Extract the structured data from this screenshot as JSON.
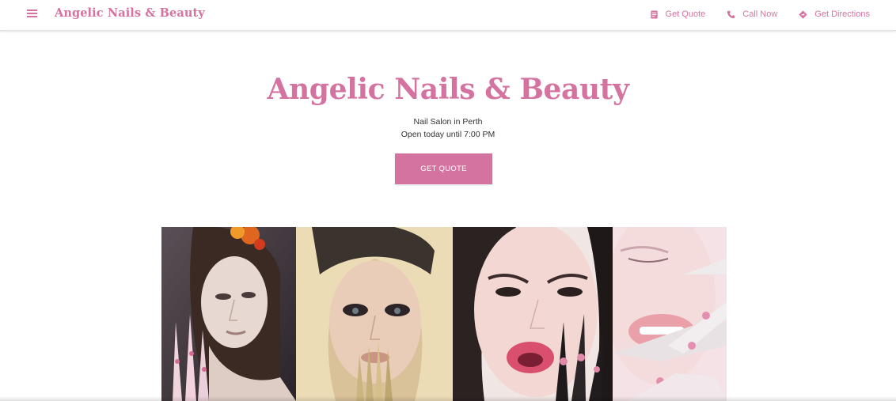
{
  "header": {
    "brand": "Angelic Nails & Beauty",
    "menu_icon": "hamburger-menu-icon",
    "nav": [
      {
        "label": "Get Quote",
        "icon": "quote-icon"
      },
      {
        "label": "Call Now",
        "icon": "phone-icon"
      },
      {
        "label": "Get Directions",
        "icon": "directions-icon"
      }
    ]
  },
  "hero": {
    "title": "Angelic Nails & Beauty",
    "subtitle": "Nail Salon in Perth",
    "hours": "Open today until 7:00 PM",
    "cta_label": "GET QUOTE"
  },
  "colors": {
    "accent": "#d4739f",
    "text": "#333333",
    "background": "#ffffff"
  }
}
